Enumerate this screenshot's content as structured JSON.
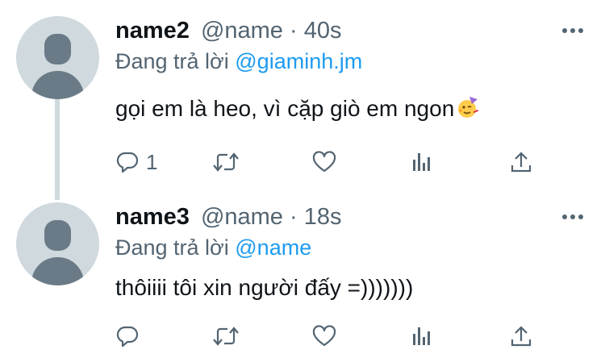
{
  "tweets": [
    {
      "name": "name2",
      "handle": "@name",
      "separator": " · ",
      "time": "40s",
      "reply_prefix": "Đang trả lời ",
      "reply_to": "@giaminh.jm",
      "text": "gọi em là heo, vì cặp giò em ngon",
      "text_emoji": "partying-face-emoji",
      "reply_count": "1",
      "icons": [
        "reply-icon",
        "retweet-icon",
        "like-icon",
        "analytics-icon",
        "share-icon",
        "more-icon"
      ]
    },
    {
      "name": "name3",
      "handle": "@name",
      "separator": " · ",
      "time": "18s",
      "reply_prefix": "Đang trả lời ",
      "reply_to": "@name",
      "text": "thôiiii tôi xin người đấy =)))))))",
      "reply_count": "",
      "icons": [
        "reply-icon",
        "retweet-icon",
        "like-icon",
        "analytics-icon",
        "share-icon",
        "more-icon"
      ]
    }
  ],
  "colors": {
    "text": "#0f1419",
    "secondary": "#536471",
    "accent": "#1d9bf0",
    "avatar_bg": "#cfd9de",
    "avatar_fg": "#6a7b87"
  }
}
